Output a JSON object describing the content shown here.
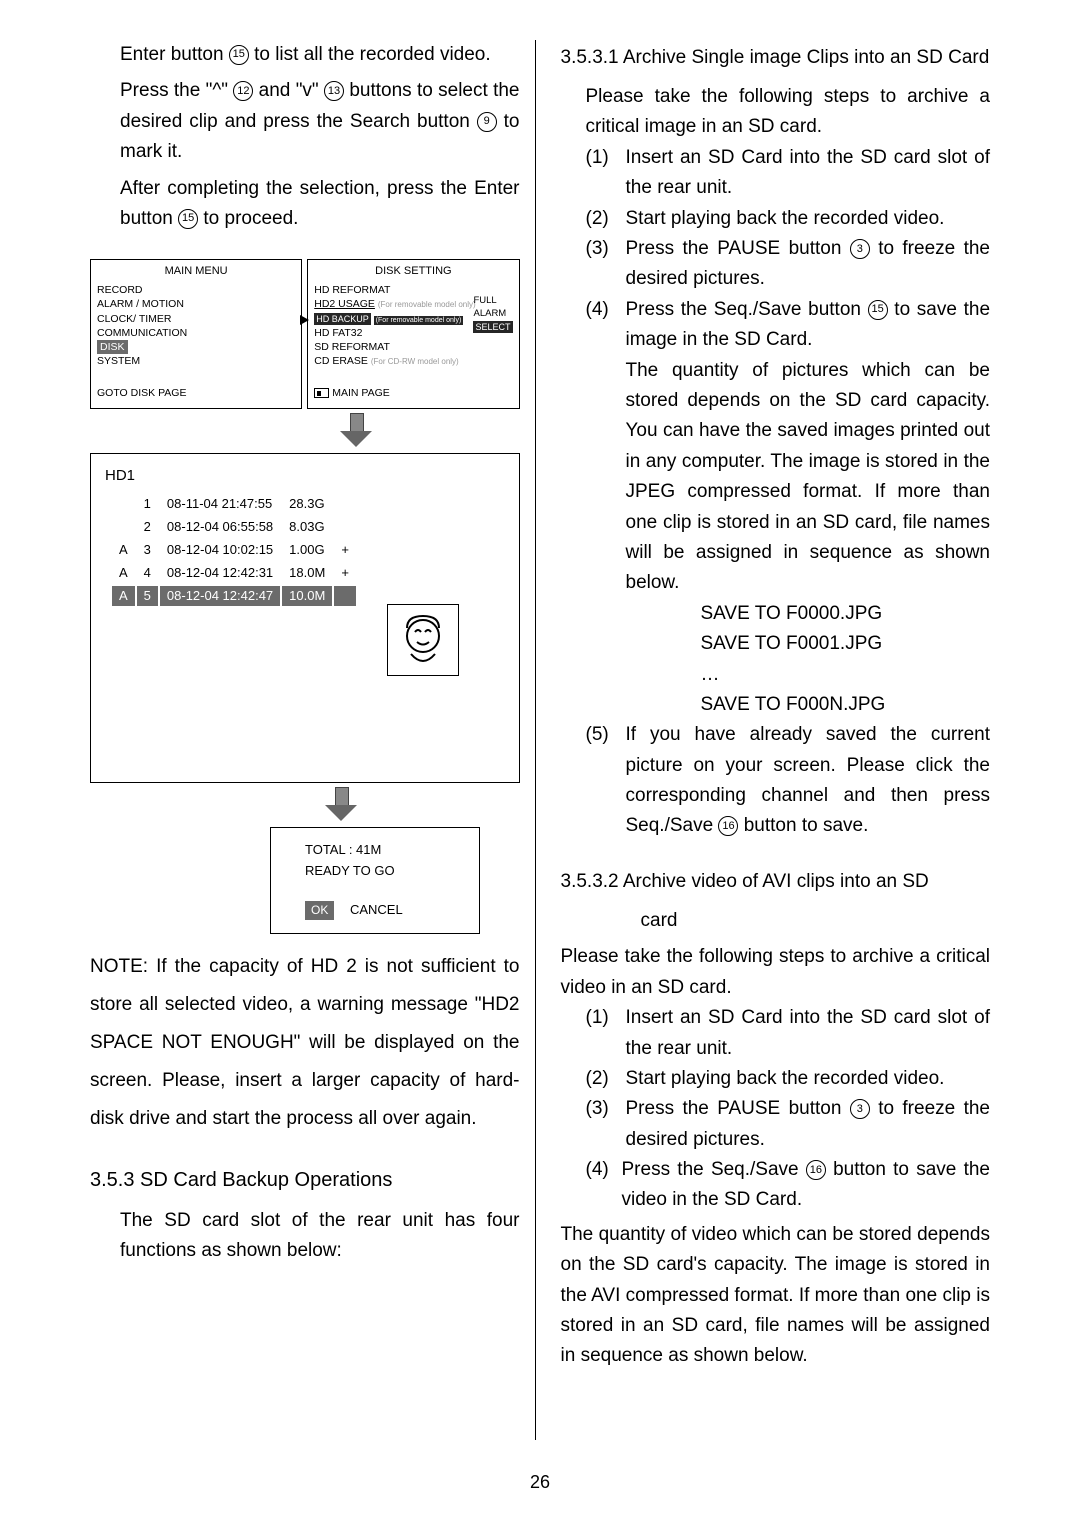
{
  "left": {
    "p1_a": "Enter button ",
    "p1_b": " to list all the recorded video.",
    "p2_a": "Press the \"^\" ",
    "p2_b": " and \"v\" ",
    "p2_c": " buttons to select the desired clip and press the Search button ",
    "p2_d": " to mark it.",
    "p3_a": "After completing the selection, press the Enter button ",
    "p3_b": " to proceed.",
    "menu1": {
      "title": "MAIN MENU",
      "items": [
        "RECORD",
        "ALARM / MOTION",
        "CLOCK/ TIMER",
        "COMMUNICATION"
      ],
      "sel": "DISK",
      "after": "SYSTEM",
      "goto": "GOTO DISK PAGE"
    },
    "menu2": {
      "title": "DISK SETTING",
      "l1": "HD REFORMAT",
      "l2a": "HD2 USAGE",
      "l2b": "(For removable model only)",
      "l3a": "HD BACKUP",
      "l3b": "(For removable model only)",
      "l4": "HD FAT32",
      "l5": "SD REFORMAT",
      "l6a": "CD ERASE",
      "l6b": "(For CD-RW model only)",
      "r1": "FULL",
      "r2": "ALARM",
      "rsel": "SELECT",
      "main": "MAIN PAGE"
    },
    "hd": {
      "title": "HD1",
      "rows": [
        {
          "a": "",
          "n": "1",
          "t": "08-11-04 21:47:55",
          "s": "28.3G",
          "m": ""
        },
        {
          "a": "",
          "n": "2",
          "t": "08-12-04 06:55:58",
          "s": "8.03G",
          "m": ""
        },
        {
          "a": "A",
          "n": "3",
          "t": "08-12-04 10:02:15",
          "s": "1.00G",
          "m": "+"
        },
        {
          "a": "A",
          "n": "4",
          "t": "08-12-04 12:42:31",
          "s": "18.0M",
          "m": "+"
        },
        {
          "a": "A",
          "n": "5",
          "t": "08-12-04 12:42:47",
          "s": "10.0M",
          "m": ""
        }
      ]
    },
    "ready": {
      "l1": "TOTAL :  41M",
      "l2": "READY  TO  GO",
      "ok": "OK",
      "cancel": "CANCEL"
    },
    "note": "NOTE: If the capacity of HD 2 is not sufficient to store all selected video, a warning message \"HD2 SPACE NOT ENOUGH\" will be displayed on the screen. Please, insert a larger capacity of hard-disk drive and start the process all over again.",
    "h353": "3.5.3 SD Card Backup Operations",
    "p353": "The SD card slot of the rear unit has four functions as shown below:"
  },
  "right": {
    "h1": "3.5.3.1 Archive Single image Clips into an SD Card",
    "intro": "Please take the following steps to archive a critical image in an SD card.",
    "s1": {
      "n": "(1)",
      "t": "Insert an SD Card into the SD card slot of the rear unit."
    },
    "s2": {
      "n": "(2)",
      "t": "Start playing back the recorded video."
    },
    "s3": {
      "n": "(3)",
      "a": "Press the PAUSE button ",
      "b": " to freeze the desired pictures."
    },
    "s4": {
      "n": "(4)",
      "a": "Press the Seq./Save button ",
      "b": " to save the image in the SD Card."
    },
    "s4c": "The quantity of pictures which can be stored depends on the SD card capacity. You can have the saved images printed out in any computer. The image is stored in the JPEG compressed format. If more than one clip is stored in an SD card, file names will be assigned in sequence as shown below.",
    "save1": "SAVE TO F0000.JPG",
    "save2": "SAVE TO F0001.JPG",
    "save3": "…",
    "save4": "SAVE TO F000N.JPG",
    "s5": {
      "n": "(5)",
      "a": "If you have already saved the current picture on your screen. Please click the corresponding channel and then press Seq./Save ",
      "b": " button to save."
    },
    "h2a": "3.5.3.2  Archive video of AVI clips into an SD",
    "h2b": "card",
    "intro2": "Please take the following steps to archive a critical video in an SD card.",
    "t1": {
      "n": "(1)",
      "t": "Insert an SD Card into the SD card slot of the rear unit."
    },
    "t2": {
      "n": "(2)",
      "t": "Start playing back the recorded video."
    },
    "t3": {
      "n": "(3)",
      "a": "Press the PAUSE button ",
      "b": " to freeze the desired pictures."
    },
    "t4": {
      "n": "(4)",
      "a": "Press the Seq./Save ",
      "b": " button to save the video in the SD Card."
    },
    "tail": "The quantity of video which can be stored depends on the SD card's capacity. The image is stored in the AVI compressed format. If more than one clip is stored in an SD card, file names will be assigned in sequence as shown below."
  },
  "pagenum": "26",
  "icons": {
    "b15": "15",
    "b12": "12",
    "b13": "13",
    "b9": "9",
    "b3": "3",
    "b16": "16"
  }
}
